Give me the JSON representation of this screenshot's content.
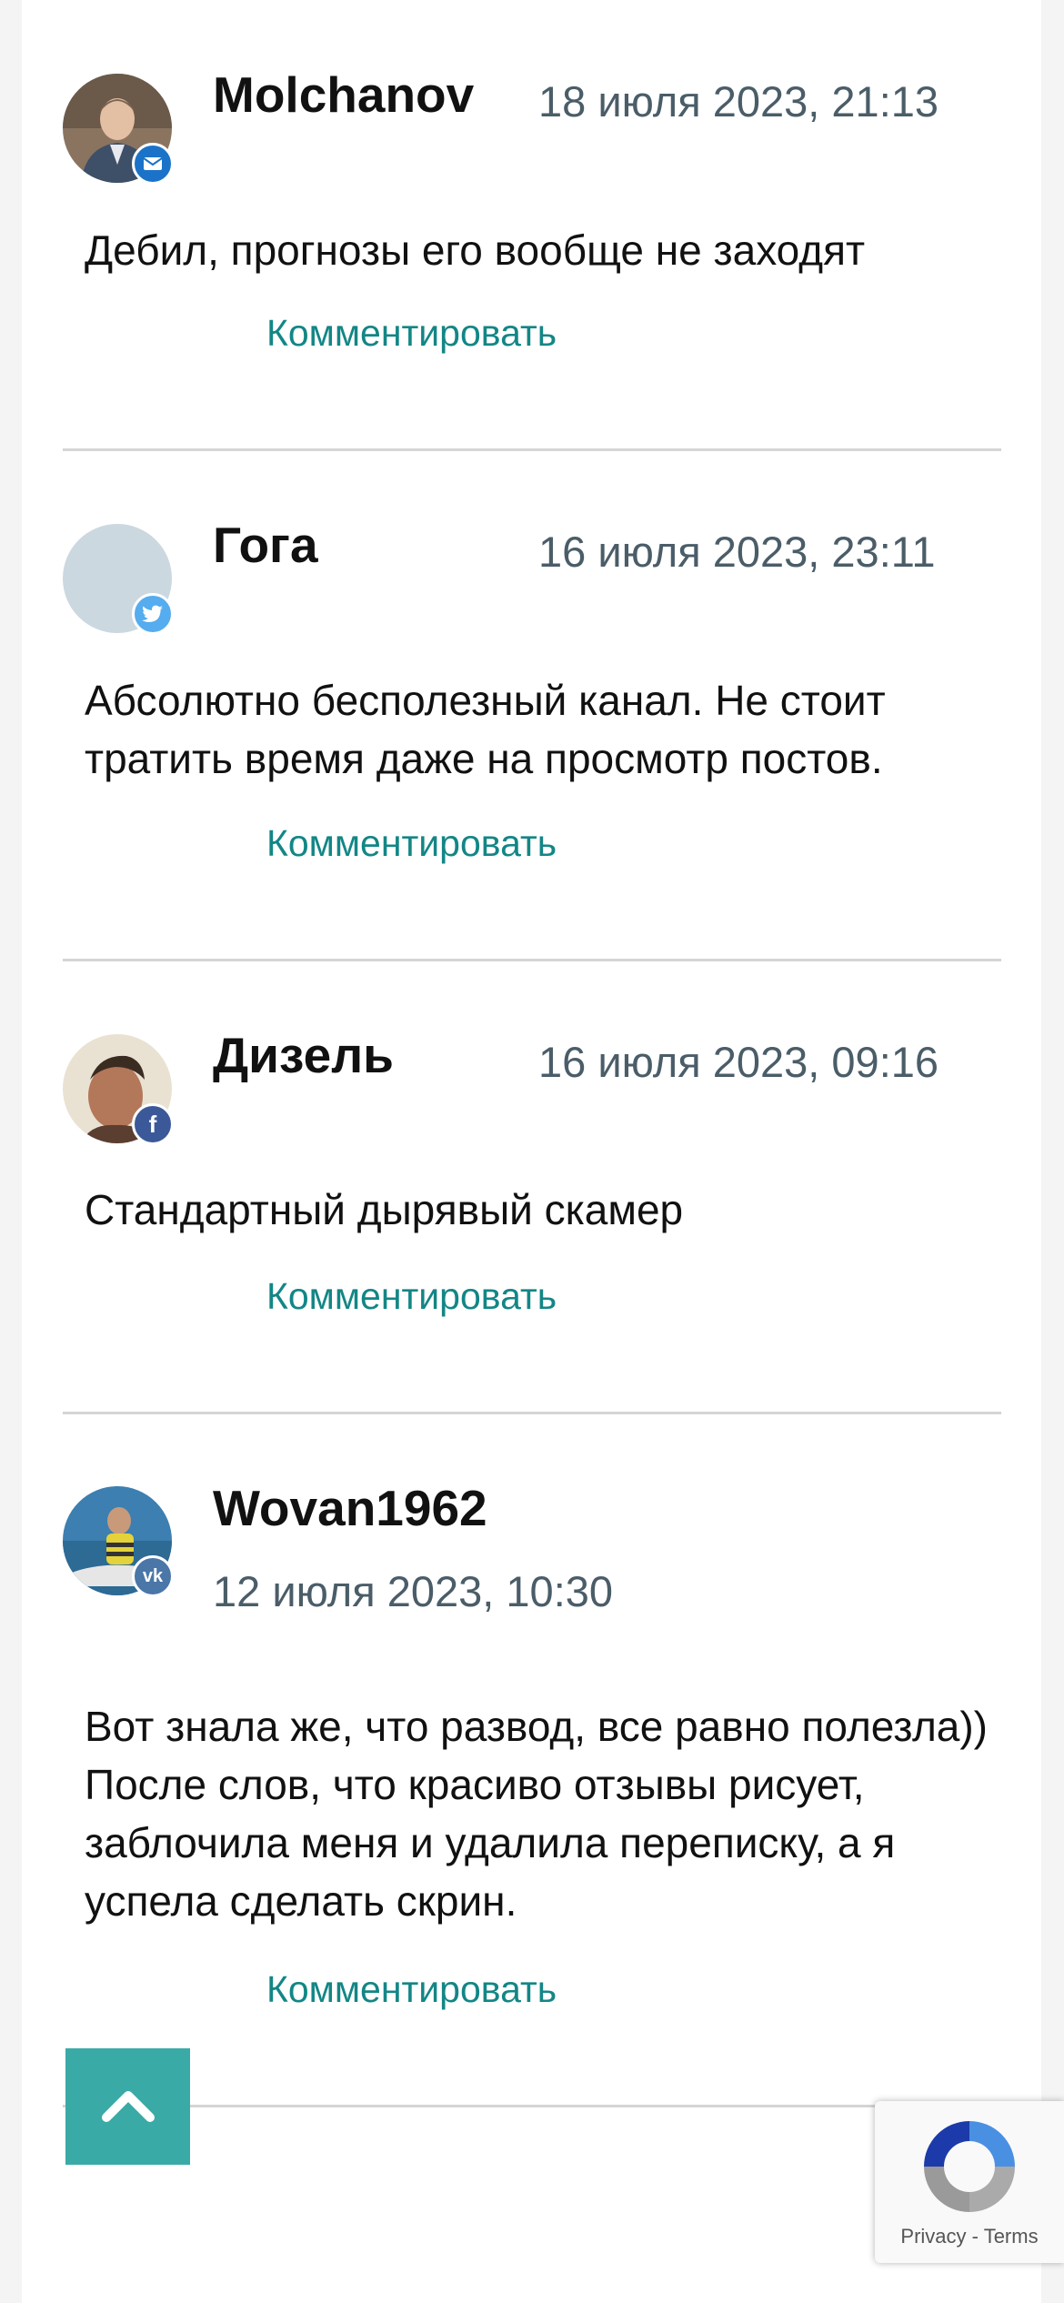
{
  "comments": [
    {
      "author": "Molchanov",
      "date": "18 июля 2023, 21:13",
      "text": "Дебил, прогнозы его вообще не заходят",
      "reply_label": "Комментировать",
      "network": "email-icon",
      "network_color": "#1a73c8"
    },
    {
      "author": "Гога",
      "date": "16 июля 2023, 23:11",
      "text": "Абсолютно бесполезный канал. Не стоит тратить время даже на просмотр постов.",
      "reply_label": "Комментировать",
      "network": "twitter-icon",
      "network_color": "#55acee"
    },
    {
      "author": "Дизель",
      "date": "16 июля 2023, 09:16",
      "text": "Стандартный дырявый скамер",
      "reply_label": "Комментировать",
      "network": "facebook-icon",
      "network_color": "#3b5998"
    },
    {
      "author": "Wovan1962",
      "date": "12 июля 2023, 10:30",
      "text": "Вот знала же, что развод, все равно полезла)) После слов, что красиво отзывы рисует, заблочила меня и удалила переписку, а я успела сделать скрин.",
      "reply_label": "Комментировать",
      "network": "vk-icon",
      "network_color": "#4a76a8"
    }
  ],
  "scroll_top": {
    "icon": "chevron-up-icon",
    "color": "#3aaaa6"
  },
  "recaptcha": {
    "privacy": "Privacy",
    "separator": " - ",
    "terms": "Terms"
  },
  "colors": {
    "link": "#138686",
    "date": "#4a5d68"
  }
}
